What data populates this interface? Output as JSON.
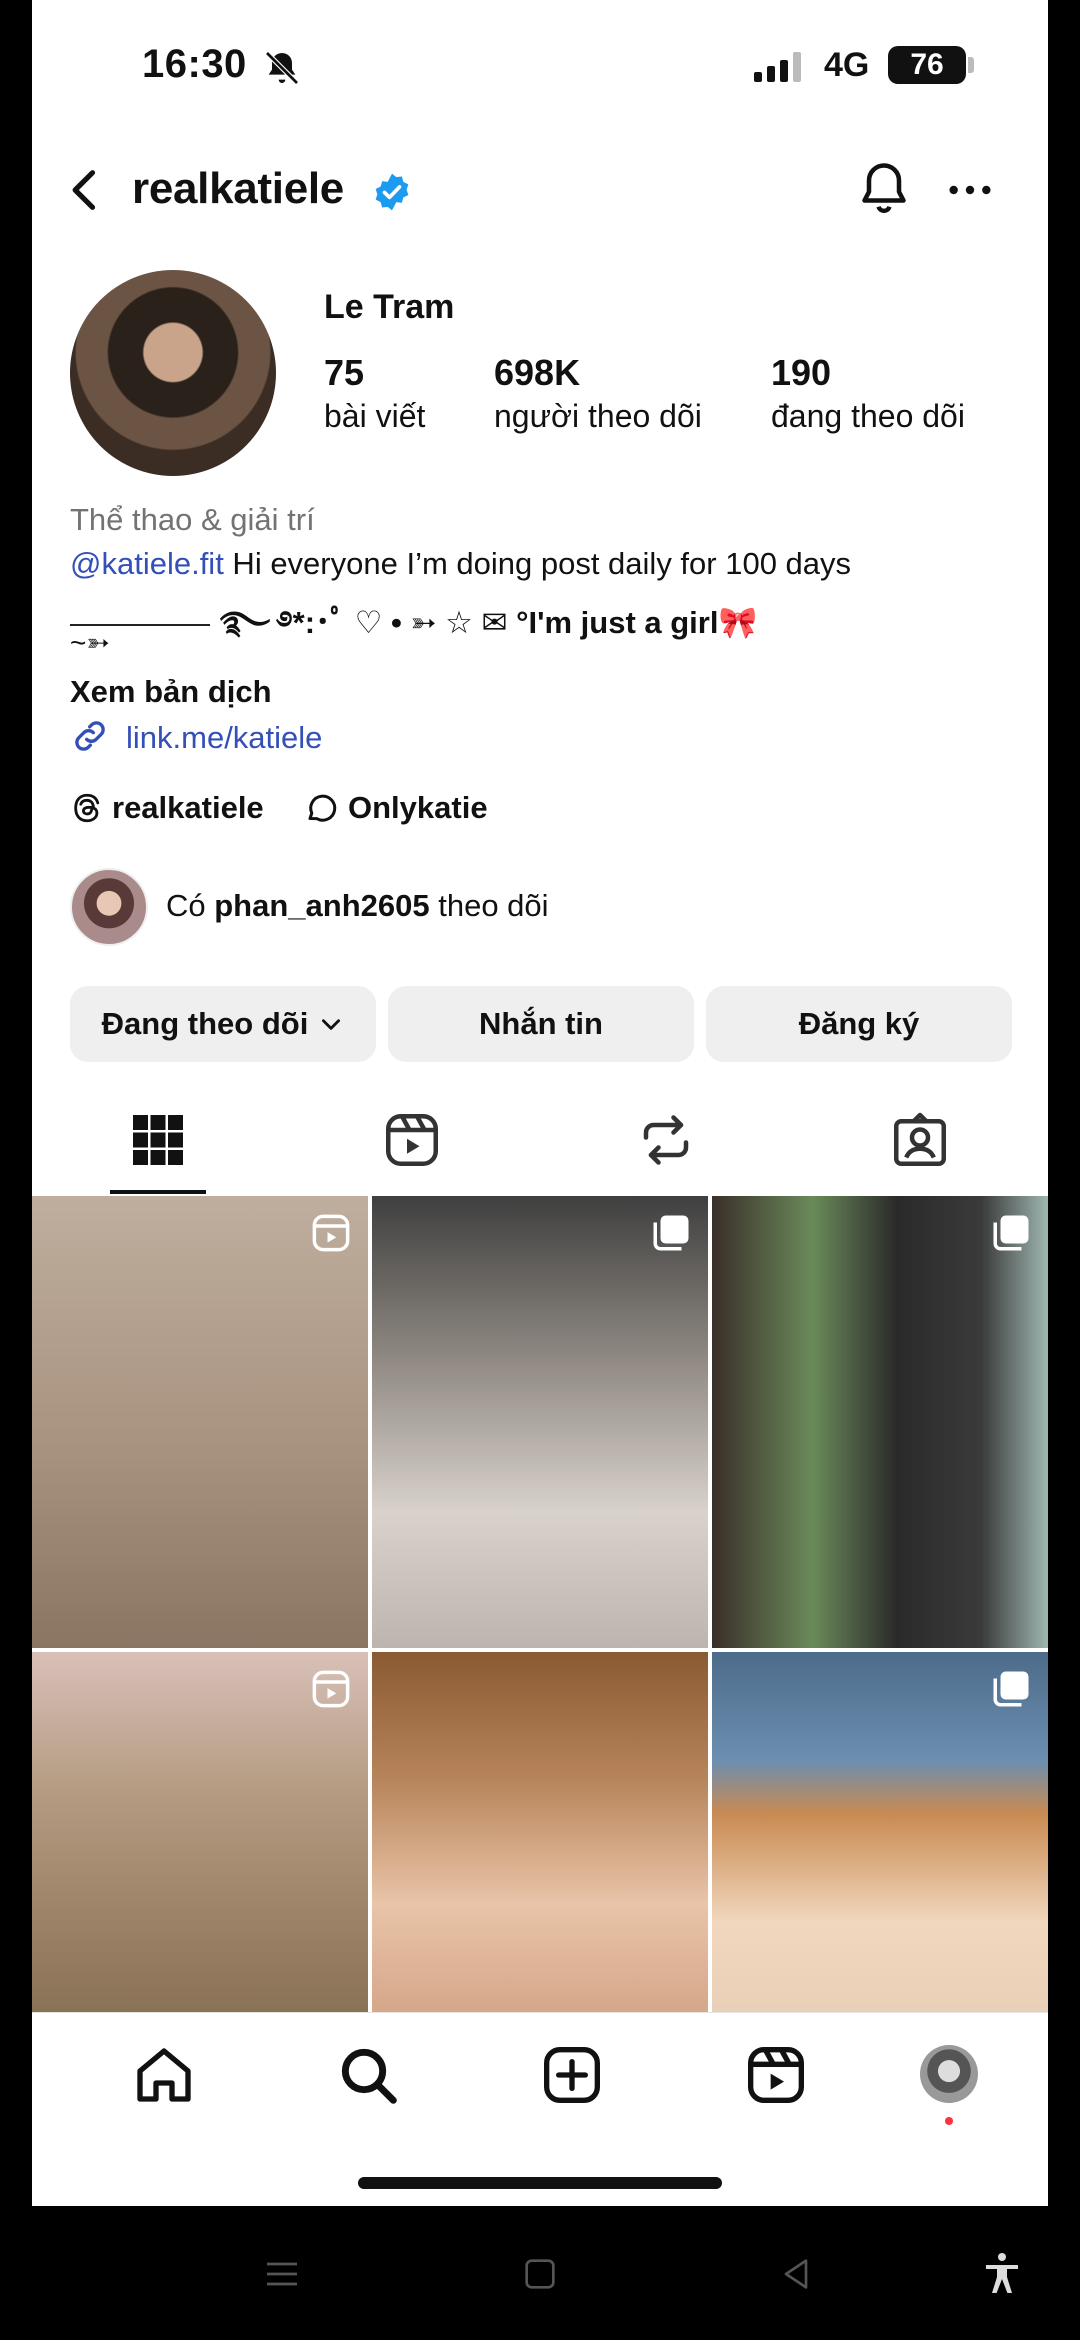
{
  "status_bar": {
    "time": "16:30",
    "network": "4G",
    "battery": "76",
    "icons": [
      "bell-slash-icon",
      "signal-icon",
      "battery-icon"
    ]
  },
  "header": {
    "username": "realkatiele",
    "verified": true,
    "icons": [
      "back-arrow-icon",
      "verified-badge-icon",
      "bell-icon",
      "more-icon"
    ]
  },
  "profile": {
    "display_name": "Le Tram",
    "stats": [
      {
        "number": "75",
        "label": "bài viết"
      },
      {
        "number": "698K",
        "label": "người theo dõi"
      },
      {
        "number": "190",
        "label": "đang theo dõi"
      }
    ],
    "category": "Thể thao & giải trí",
    "bio_mention": "@katiele.fit",
    "bio_line1": " Hi everyone I’m doing post daily for 100 days",
    "bio_line2": "࿐ ࿔*:･ﾟ ♡ • ➳ ☆ ✉ °I'm just a girl🎀",
    "bio_line3": "~➳",
    "translate": "Xem bản dịch",
    "link": "link.me/katiele",
    "threads_handle": "realkatiele",
    "secondary_handle": "Onlykatie",
    "followed_by_prefix": "Có ",
    "followed_by_user": "phan_anh2605",
    "followed_by_suffix": " theo dõi"
  },
  "actions": {
    "following": "Đang theo dõi",
    "message": "Nhắn tin",
    "subscribe": "Đăng ký"
  },
  "tabs": [
    "grid-icon",
    "reels-icon",
    "reposts-icon",
    "tagged-icon"
  ],
  "bottom_nav": [
    "home-icon",
    "search-icon",
    "create-icon",
    "reels-icon",
    "profile-avatar"
  ],
  "colors": {
    "link": "#3450b8",
    "verified": "#1d9bf0",
    "muted": "#737373",
    "button_bg": "#efefef",
    "notification_dot": "#ff3040"
  }
}
